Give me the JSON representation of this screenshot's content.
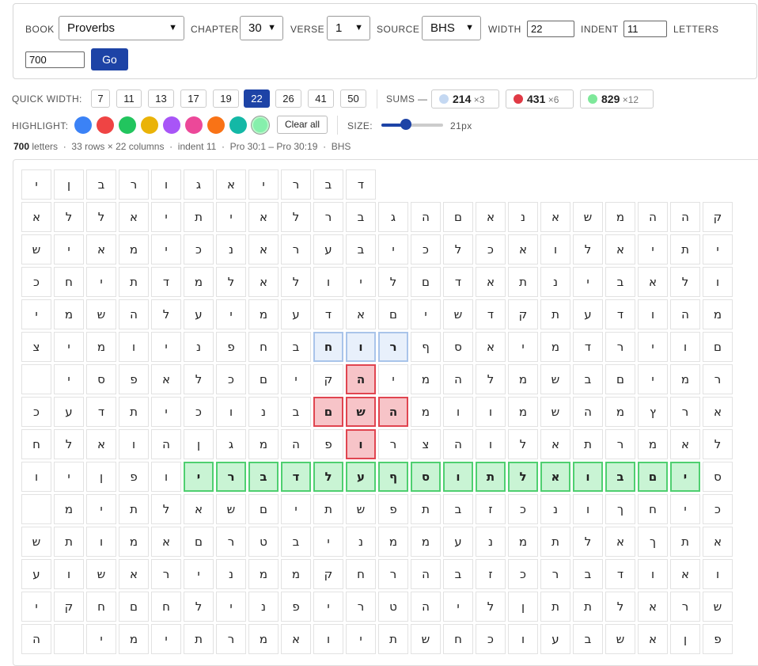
{
  "controls": {
    "book_label": "BOOK",
    "book_value": "Proverbs",
    "chapter_label": "CHAPTER",
    "chapter_value": "30",
    "verse_label": "VERSE",
    "verse_value": "1",
    "source_label": "SOURCE",
    "source_value": "BHS",
    "width_label": "WIDTH",
    "width_value": "22",
    "indent_label": "INDENT",
    "indent_value": "11",
    "letters_label": "LETTERS",
    "letters_value": "700",
    "go_label": "Go"
  },
  "quick_width": {
    "label": "QUICK WIDTH:",
    "options": [
      "7",
      "11",
      "13",
      "17",
      "19",
      "22",
      "26",
      "41",
      "50"
    ],
    "active": "22"
  },
  "sums": {
    "label": "SUMS —",
    "items": [
      {
        "value": "214",
        "mult": "×3",
        "color": "#c4d8f2"
      },
      {
        "value": "431",
        "mult": "×6",
        "color": "#e03a45"
      },
      {
        "value": "829",
        "mult": "×12",
        "color": "#7ee89a"
      }
    ]
  },
  "highlight": {
    "label": "HIGHLIGHT:",
    "colors": [
      "#3b82f6",
      "#ef4444",
      "#22c55e",
      "#eab308",
      "#a855f7",
      "#ec4899",
      "#f97316",
      "#14b8a6",
      "#86efac"
    ],
    "clear_label": "Clear all"
  },
  "size": {
    "label": "SIZE:",
    "value": "21px",
    "level": 0.4
  },
  "info": {
    "count": "700",
    "count_suffix": " letters",
    "rows_cols": "33 rows × 22 columns",
    "indent": "indent 11",
    "range": "Pro 30:1 – Pro 30:19",
    "source": "BHS",
    "sep": "·"
  },
  "grid": {
    "rows": [
      [
        "",
        "",
        "",
        "",
        "",
        "",
        "",
        "",
        "",
        "",
        "",
        "ד",
        "ב",
        "ר",
        "י",
        "א",
        "ג",
        "ו",
        "ר",
        "ב",
        "ן",
        "י"
      ],
      [
        "ק",
        "ה",
        "ה",
        "מ",
        "ש",
        "א",
        "נ",
        "א",
        "ם",
        "ה",
        "ג",
        "ב",
        "ר",
        "ל",
        "א",
        "י",
        "ת",
        "י",
        "א",
        "ל",
        "ל",
        "א"
      ],
      [
        "י",
        "ת",
        "י",
        "א",
        "ל",
        "ו",
        "א",
        "כ",
        "ל",
        "כ",
        "י",
        "ב",
        "ע",
        "ר",
        "א",
        "נ",
        "כ",
        "י",
        "מ",
        "א",
        "י",
        "ש"
      ],
      [
        "ו",
        "ל",
        "א",
        "ב",
        "י",
        "נ",
        "ת",
        "א",
        "ד",
        "ם",
        "ל",
        "י",
        "ו",
        "ל",
        "א",
        "ל",
        "מ",
        "ד",
        "ת",
        "י",
        "ח",
        "כ"
      ],
      [
        "מ",
        "ה",
        "ו",
        "ד",
        "ע",
        "ת",
        "ק",
        "ד",
        "ש",
        "י",
        "ם",
        "א",
        "ד",
        "ע",
        "מ",
        "י",
        "ע",
        "ל",
        "ה",
        "ש",
        "מ",
        "י"
      ],
      [
        "ם",
        "ו",
        "י",
        "ר",
        "ד",
        "מ",
        "י",
        "א",
        "ס",
        "ף",
        "ר",
        "ו",
        "ח",
        "ב",
        "ח",
        "פ",
        "נ",
        "י",
        "ו",
        "מ",
        "י",
        "צ"
      ],
      [
        "ר",
        "מ",
        "י",
        "ם",
        "ב",
        "ש",
        "מ",
        "ל",
        "ה",
        "מ",
        "י",
        "ה",
        "ק",
        "י",
        "ם",
        "כ",
        "ל",
        "א",
        "פ",
        "ס",
        "י",
        ""
      ],
      [
        "א",
        "ר",
        "ץ",
        "מ",
        "ה",
        "ש",
        "מ",
        "ו",
        "ו",
        "מ",
        "ה",
        "ש",
        "ם",
        "ב",
        "נ",
        "ו",
        "כ",
        "י",
        "ת",
        "ד",
        "ע",
        "כ"
      ],
      [
        "ל",
        "א",
        "מ",
        "ר",
        "ת",
        "א",
        "ל",
        "ו",
        "ה",
        "צ",
        "ר",
        "ו",
        "פ",
        "ה",
        "מ",
        "ג",
        "ן",
        "ה",
        "ו",
        "א",
        "ל",
        "ח"
      ],
      [
        "ס",
        "י",
        "ם",
        "ב",
        "ו",
        "א",
        "ל",
        "ת",
        "ו",
        "ס",
        "ף",
        "ע",
        "ל",
        "ד",
        "ב",
        "ר",
        "י",
        "ו",
        "פ",
        "ן",
        "י",
        "ו"
      ],
      [
        "כ",
        "י",
        "ח",
        "ך",
        "ו",
        "נ",
        "כ",
        "ז",
        "ב",
        "ת",
        "פ",
        "ש",
        "ת",
        "י",
        "ם",
        "ש",
        "א",
        "ל",
        "ת",
        "י",
        "מ",
        ""
      ],
      [
        "א",
        "ת",
        "ך",
        "א",
        "ל",
        "ת",
        "מ",
        "נ",
        "ע",
        "מ",
        "מ",
        "נ",
        "י",
        "ב",
        "ט",
        "ר",
        "ם",
        "א",
        "מ",
        "ו",
        "ת",
        "ש"
      ],
      [
        "ו",
        "א",
        "ו",
        "ד",
        "ב",
        "ר",
        "כ",
        "ז",
        "ב",
        "ה",
        "ר",
        "ח",
        "ק",
        "מ",
        "מ",
        "נ",
        "י",
        "ר",
        "א",
        "ש",
        "ו",
        "ע"
      ],
      [
        "ש",
        "ר",
        "א",
        "ל",
        "ת",
        "ת",
        "ן",
        "ל",
        "י",
        "ה",
        "ט",
        "ר",
        "י",
        "פ",
        "נ",
        "י",
        "ל",
        "ח",
        "ם",
        "ח",
        "ק",
        "י"
      ],
      [
        "פ",
        "ן",
        "א",
        "ש",
        "ב",
        "ע",
        "ו",
        "כ",
        "ח",
        "ש",
        "ת",
        "י",
        "ו",
        "א",
        "מ",
        "ר",
        "ת",
        "י",
        "מ",
        "י",
        "",
        "ה"
      ]
    ],
    "highlight_map": [
      "......................",
      "......................",
      "......................",
      "......................",
      "......................",
      "..........BBB.........",
      "...........R..........",
      "..........RRR.........",
      "...........R..........",
      ".GGGGGGGGGGGGGGGG.....",
      "......................",
      "......................",
      "......................",
      "......................",
      "......................"
    ]
  }
}
